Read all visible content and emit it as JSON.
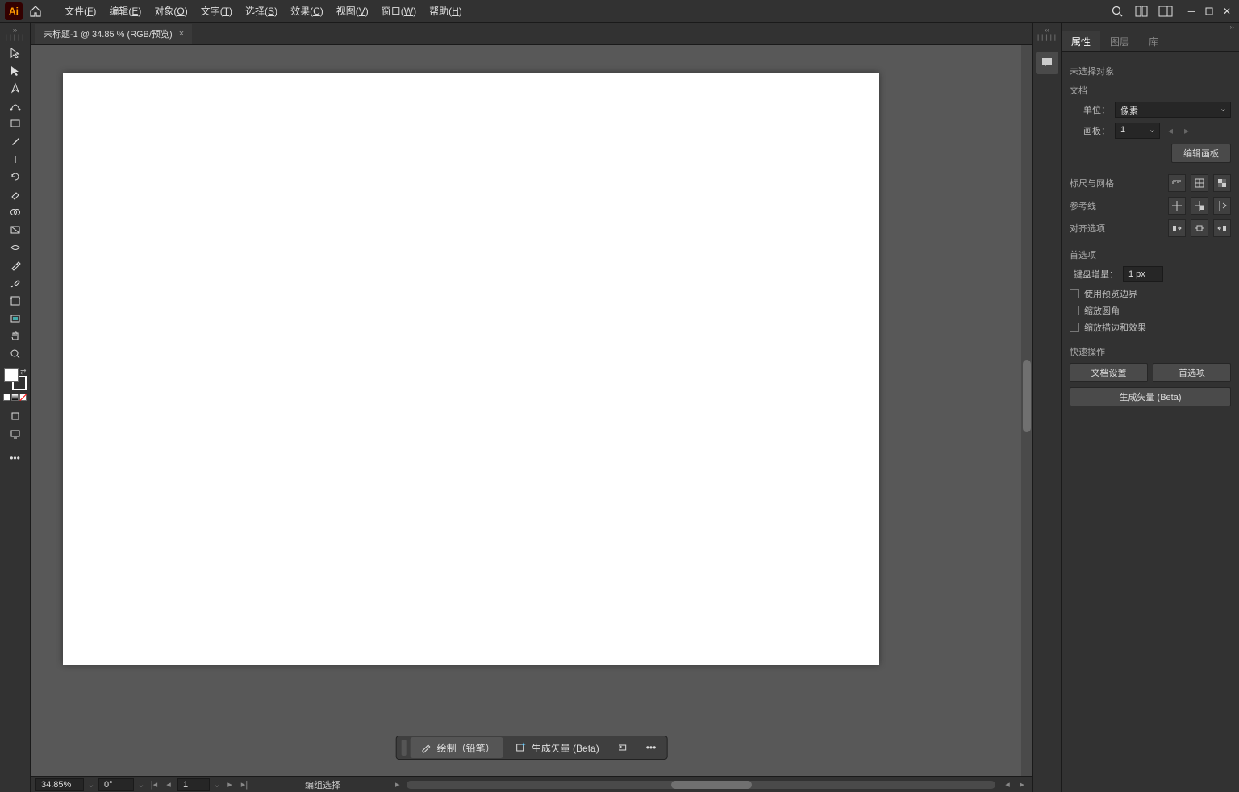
{
  "menubar": {
    "items": [
      {
        "label": "文件(",
        "key": "F",
        "suffix": ")"
      },
      {
        "label": "编辑(",
        "key": "E",
        "suffix": ")"
      },
      {
        "label": "对象(",
        "key": "O",
        "suffix": ")"
      },
      {
        "label": "文字(",
        "key": "T",
        "suffix": ")"
      },
      {
        "label": "选择(",
        "key": "S",
        "suffix": ")"
      },
      {
        "label": "效果(",
        "key": "C",
        "suffix": ")"
      },
      {
        "label": "视图(",
        "key": "V",
        "suffix": ")"
      },
      {
        "label": "窗口(",
        "key": "W",
        "suffix": ")"
      },
      {
        "label": "帮助(",
        "key": "H",
        "suffix": ")"
      }
    ]
  },
  "tab": {
    "title": "未标题-1 @ 34.85 % (RGB/预览)"
  },
  "floatbar": {
    "draw_label": "绘制（铅笔）",
    "gen_label": "生成矢量 (Beta)"
  },
  "statusbar": {
    "zoom": "34.85%",
    "rotation": "0°",
    "artboard": "1",
    "mode": "编组选择"
  },
  "panel": {
    "tabs": [
      "属性",
      "图层",
      "库"
    ],
    "noSelection": "未选择对象",
    "docSection": "文档",
    "unitsLabel": "单位：",
    "unitsValue": "像素",
    "artboardLabel": "画板：",
    "artboardValue": "1",
    "editArtboard": "编辑画板",
    "rulerGrid": "标尺与网格",
    "guides": "参考线",
    "alignOptions": "对齐选项",
    "prefsSection": "首选项",
    "kbIncLabel": "键盘增量：",
    "kbIncValue": "1 px",
    "usePreview": "使用预览边界",
    "scaleCorner": "缩放圆角",
    "scaleStroke": "缩放描边和效果",
    "quickActions": "快速操作",
    "docSetup": "文档设置",
    "prefsBtn": "首选项",
    "genVector": "生成矢量 (Beta)"
  }
}
